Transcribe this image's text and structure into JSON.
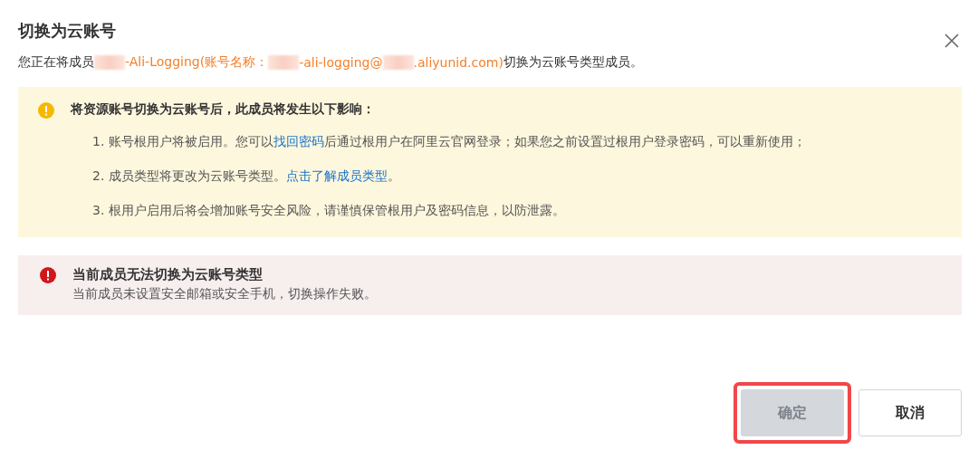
{
  "dialog": {
    "title": "切换为云账号",
    "intro": [
      {
        "kind": "text",
        "text": "您正在将成员"
      },
      {
        "kind": "redacted"
      },
      {
        "kind": "highlight",
        "text": "-Ali-Logging(账号名称："
      },
      {
        "kind": "redacted"
      },
      {
        "kind": "highlight",
        "text": "-ali-logging@"
      },
      {
        "kind": "redacted"
      },
      {
        "kind": "highlight",
        "text": ".aliyunid.com)"
      },
      {
        "kind": "text",
        "text": " 切换为云账号类型成员。"
      }
    ],
    "warning": {
      "title": "将资源账号切换为云账号后，此成员将发生以下影响：",
      "items": [
        [
          {
            "kind": "text",
            "text": "1. 账号根用户将被启用。您可以"
          },
          {
            "kind": "link",
            "text": "找回密码"
          },
          {
            "kind": "text",
            "text": "后通过根用户在阿里云官网登录；如果您之前设置过根用户登录密码，可以重新使用；"
          }
        ],
        [
          {
            "kind": "text",
            "text": "2. 成员类型将更改为云账号类型。"
          },
          {
            "kind": "link",
            "text": "点击了解成员类型"
          },
          {
            "kind": "text",
            "text": "。"
          }
        ],
        [
          {
            "kind": "text",
            "text": "3. 根用户启用后将会增加账号安全风险，请谨慎保管根用户及密码信息，以防泄露。"
          }
        ]
      ]
    },
    "error": {
      "title": "当前成员无法切换为云账号类型",
      "message": "当前成员未设置安全邮箱或安全手机，切换操作失败。"
    },
    "buttons": [
      {
        "label": "确定",
        "kind": "primary",
        "disabled": true,
        "highlighted": true
      },
      {
        "label": "取消",
        "kind": "secondary",
        "disabled": false,
        "highlighted": false
      }
    ]
  }
}
